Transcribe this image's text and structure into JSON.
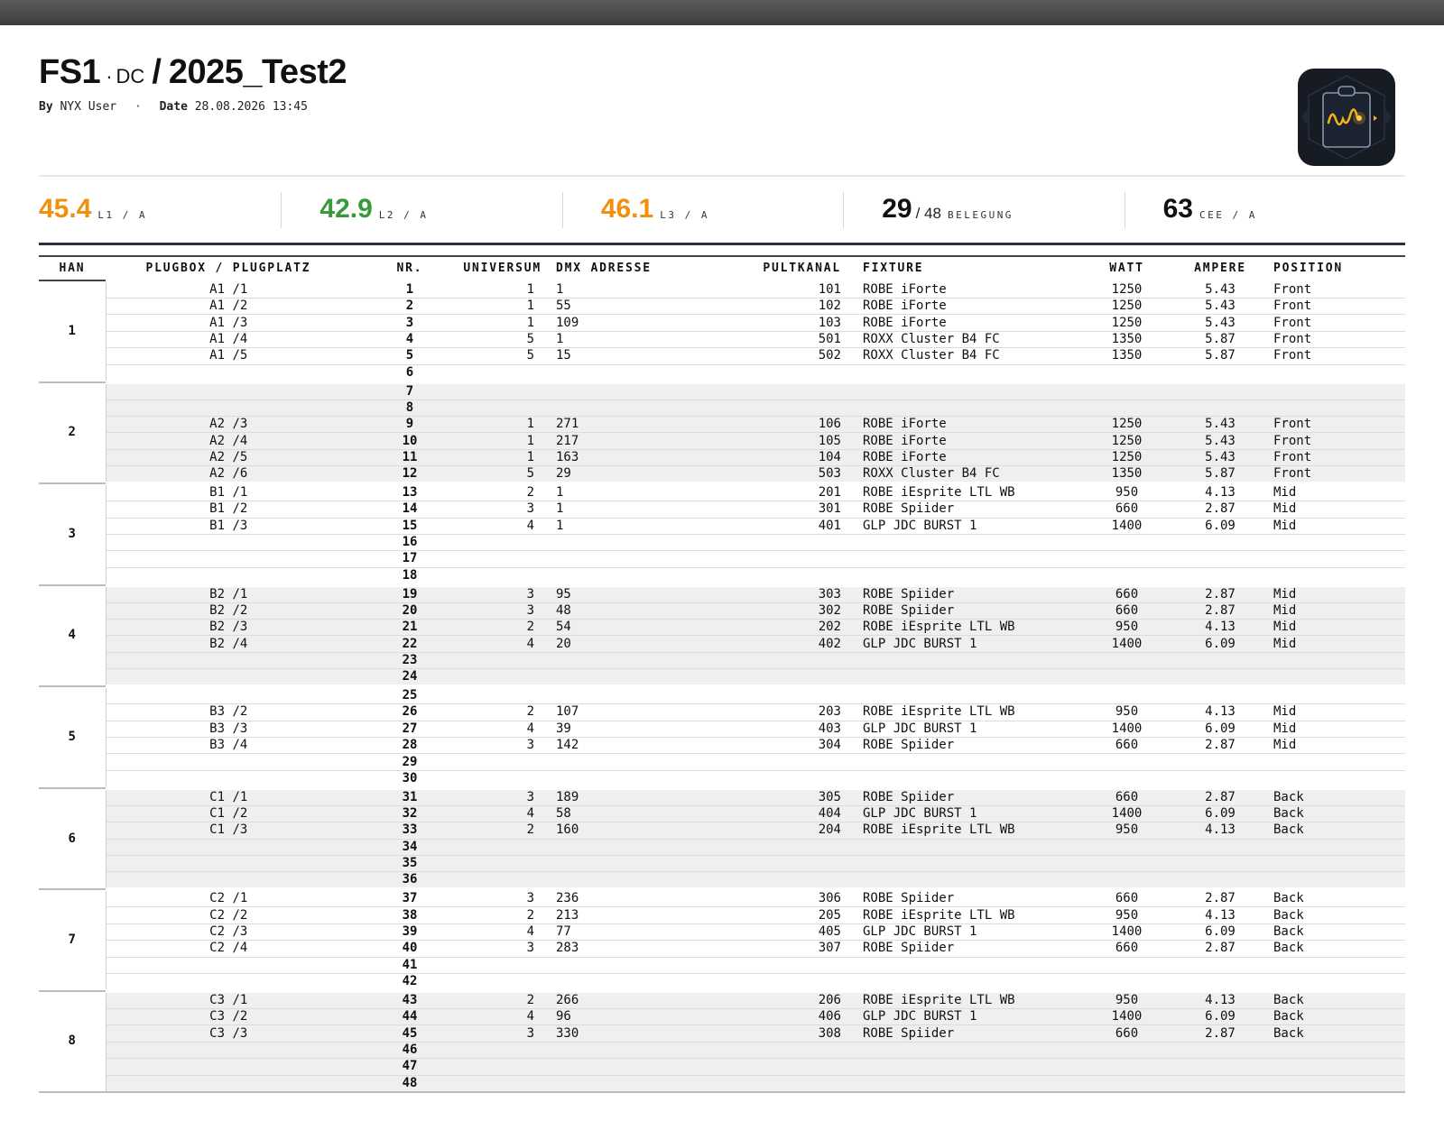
{
  "header": {
    "title_main": "FS1",
    "title_dot": "·",
    "title_sub": "DC",
    "title_slash": "/",
    "title_project": "2025_Test2",
    "by_label": "By",
    "by_value": "NYX User",
    "separator": "·",
    "date_label": "Date",
    "date_value": "28.08.2026 13:45",
    "logo_icon": "clipboard-waveform-icon"
  },
  "stats": [
    {
      "value": "45.4",
      "of": "",
      "unit": "L1 / A",
      "color": "#f0900f"
    },
    {
      "value": "42.9",
      "of": "",
      "unit": "L2 / A",
      "color": "#3a9a3a"
    },
    {
      "value": "46.1",
      "of": "",
      "unit": "L3 / A",
      "color": "#f0900f"
    },
    {
      "value": "29",
      "of": "/ 48",
      "unit": "BELEGUNG",
      "color": "#111111"
    },
    {
      "value": "63",
      "of": "",
      "unit": "CEE / A",
      "color": "#111111"
    }
  ],
  "columns": [
    "HAN",
    "PLUGBOX / PLUGPLATZ",
    "NR.",
    "UNIVERSUM",
    "DMX ADRESSE",
    "PULTKANAL",
    "FIXTURE",
    "WATT",
    "AMPERE",
    "POSITION"
  ],
  "groups": [
    {
      "han": "1",
      "rows": [
        {
          "pb": "A1 /1",
          "nr": "1",
          "uni": "1",
          "dmx": "1",
          "pult": "101",
          "fix": "ROBE iForte",
          "watt": "1250",
          "amp": "5.43",
          "pos": "Front"
        },
        {
          "pb": "A1 /2",
          "nr": "2",
          "uni": "1",
          "dmx": "55",
          "pult": "102",
          "fix": "ROBE iForte",
          "watt": "1250",
          "amp": "5.43",
          "pos": "Front"
        },
        {
          "pb": "A1 /3",
          "nr": "3",
          "uni": "1",
          "dmx": "109",
          "pult": "103",
          "fix": "ROBE iForte",
          "watt": "1250",
          "amp": "5.43",
          "pos": "Front"
        },
        {
          "pb": "A1 /4",
          "nr": "4",
          "uni": "5",
          "dmx": "1",
          "pult": "501",
          "fix": "ROXX Cluster B4 FC",
          "watt": "1350",
          "amp": "5.87",
          "pos": "Front"
        },
        {
          "pb": "A1 /5",
          "nr": "5",
          "uni": "5",
          "dmx": "15",
          "pult": "502",
          "fix": "ROXX Cluster B4 FC",
          "watt": "1350",
          "amp": "5.87",
          "pos": "Front"
        },
        {
          "pb": "",
          "nr": "6",
          "uni": "",
          "dmx": "",
          "pult": "",
          "fix": "",
          "watt": "",
          "amp": "",
          "pos": ""
        }
      ]
    },
    {
      "han": "2",
      "rows": [
        {
          "pb": "",
          "nr": "7",
          "uni": "",
          "dmx": "",
          "pult": "",
          "fix": "",
          "watt": "",
          "amp": "",
          "pos": ""
        },
        {
          "pb": "",
          "nr": "8",
          "uni": "",
          "dmx": "",
          "pult": "",
          "fix": "",
          "watt": "",
          "amp": "",
          "pos": ""
        },
        {
          "pb": "A2 /3",
          "nr": "9",
          "uni": "1",
          "dmx": "271",
          "pult": "106",
          "fix": "ROBE iForte",
          "watt": "1250",
          "amp": "5.43",
          "pos": "Front"
        },
        {
          "pb": "A2 /4",
          "nr": "10",
          "uni": "1",
          "dmx": "217",
          "pult": "105",
          "fix": "ROBE iForte",
          "watt": "1250",
          "amp": "5.43",
          "pos": "Front"
        },
        {
          "pb": "A2 /5",
          "nr": "11",
          "uni": "1",
          "dmx": "163",
          "pult": "104",
          "fix": "ROBE iForte",
          "watt": "1250",
          "amp": "5.43",
          "pos": "Front"
        },
        {
          "pb": "A2 /6",
          "nr": "12",
          "uni": "5",
          "dmx": "29",
          "pult": "503",
          "fix": "ROXX Cluster B4 FC",
          "watt": "1350",
          "amp": "5.87",
          "pos": "Front"
        }
      ]
    },
    {
      "han": "3",
      "rows": [
        {
          "pb": "B1 /1",
          "nr": "13",
          "uni": "2",
          "dmx": "1",
          "pult": "201",
          "fix": "ROBE iEsprite LTL WB",
          "watt": "950",
          "amp": "4.13",
          "pos": "Mid"
        },
        {
          "pb": "B1 /2",
          "nr": "14",
          "uni": "3",
          "dmx": "1",
          "pult": "301",
          "fix": "ROBE Spiider",
          "watt": "660",
          "amp": "2.87",
          "pos": "Mid"
        },
        {
          "pb": "B1 /3",
          "nr": "15",
          "uni": "4",
          "dmx": "1",
          "pult": "401",
          "fix": "GLP JDC BURST 1",
          "watt": "1400",
          "amp": "6.09",
          "pos": "Mid"
        },
        {
          "pb": "",
          "nr": "16",
          "uni": "",
          "dmx": "",
          "pult": "",
          "fix": "",
          "watt": "",
          "amp": "",
          "pos": ""
        },
        {
          "pb": "",
          "nr": "17",
          "uni": "",
          "dmx": "",
          "pult": "",
          "fix": "",
          "watt": "",
          "amp": "",
          "pos": ""
        },
        {
          "pb": "",
          "nr": "18",
          "uni": "",
          "dmx": "",
          "pult": "",
          "fix": "",
          "watt": "",
          "amp": "",
          "pos": ""
        }
      ]
    },
    {
      "han": "4",
      "rows": [
        {
          "pb": "B2 /1",
          "nr": "19",
          "uni": "3",
          "dmx": "95",
          "pult": "303",
          "fix": "ROBE Spiider",
          "watt": "660",
          "amp": "2.87",
          "pos": "Mid"
        },
        {
          "pb": "B2 /2",
          "nr": "20",
          "uni": "3",
          "dmx": "48",
          "pult": "302",
          "fix": "ROBE Spiider",
          "watt": "660",
          "amp": "2.87",
          "pos": "Mid"
        },
        {
          "pb": "B2 /3",
          "nr": "21",
          "uni": "2",
          "dmx": "54",
          "pult": "202",
          "fix": "ROBE iEsprite LTL WB",
          "watt": "950",
          "amp": "4.13",
          "pos": "Mid"
        },
        {
          "pb": "B2 /4",
          "nr": "22",
          "uni": "4",
          "dmx": "20",
          "pult": "402",
          "fix": "GLP JDC BURST 1",
          "watt": "1400",
          "amp": "6.09",
          "pos": "Mid"
        },
        {
          "pb": "",
          "nr": "23",
          "uni": "",
          "dmx": "",
          "pult": "",
          "fix": "",
          "watt": "",
          "amp": "",
          "pos": ""
        },
        {
          "pb": "",
          "nr": "24",
          "uni": "",
          "dmx": "",
          "pult": "",
          "fix": "",
          "watt": "",
          "amp": "",
          "pos": ""
        }
      ]
    },
    {
      "han": "5",
      "rows": [
        {
          "pb": "",
          "nr": "25",
          "uni": "",
          "dmx": "",
          "pult": "",
          "fix": "",
          "watt": "",
          "amp": "",
          "pos": ""
        },
        {
          "pb": "B3 /2",
          "nr": "26",
          "uni": "2",
          "dmx": "107",
          "pult": "203",
          "fix": "ROBE iEsprite LTL WB",
          "watt": "950",
          "amp": "4.13",
          "pos": "Mid"
        },
        {
          "pb": "B3 /3",
          "nr": "27",
          "uni": "4",
          "dmx": "39",
          "pult": "403",
          "fix": "GLP JDC BURST 1",
          "watt": "1400",
          "amp": "6.09",
          "pos": "Mid"
        },
        {
          "pb": "B3 /4",
          "nr": "28",
          "uni": "3",
          "dmx": "142",
          "pult": "304",
          "fix": "ROBE Spiider",
          "watt": "660",
          "amp": "2.87",
          "pos": "Mid"
        },
        {
          "pb": "",
          "nr": "29",
          "uni": "",
          "dmx": "",
          "pult": "",
          "fix": "",
          "watt": "",
          "amp": "",
          "pos": ""
        },
        {
          "pb": "",
          "nr": "30",
          "uni": "",
          "dmx": "",
          "pult": "",
          "fix": "",
          "watt": "",
          "amp": "",
          "pos": ""
        }
      ]
    },
    {
      "han": "6",
      "rows": [
        {
          "pb": "C1 /1",
          "nr": "31",
          "uni": "3",
          "dmx": "189",
          "pult": "305",
          "fix": "ROBE Spiider",
          "watt": "660",
          "amp": "2.87",
          "pos": "Back"
        },
        {
          "pb": "C1 /2",
          "nr": "32",
          "uni": "4",
          "dmx": "58",
          "pult": "404",
          "fix": "GLP JDC BURST 1",
          "watt": "1400",
          "amp": "6.09",
          "pos": "Back"
        },
        {
          "pb": "C1 /3",
          "nr": "33",
          "uni": "2",
          "dmx": "160",
          "pult": "204",
          "fix": "ROBE iEsprite LTL WB",
          "watt": "950",
          "amp": "4.13",
          "pos": "Back"
        },
        {
          "pb": "",
          "nr": "34",
          "uni": "",
          "dmx": "",
          "pult": "",
          "fix": "",
          "watt": "",
          "amp": "",
          "pos": ""
        },
        {
          "pb": "",
          "nr": "35",
          "uni": "",
          "dmx": "",
          "pult": "",
          "fix": "",
          "watt": "",
          "amp": "",
          "pos": ""
        },
        {
          "pb": "",
          "nr": "36",
          "uni": "",
          "dmx": "",
          "pult": "",
          "fix": "",
          "watt": "",
          "amp": "",
          "pos": ""
        }
      ]
    },
    {
      "han": "7",
      "rows": [
        {
          "pb": "C2 /1",
          "nr": "37",
          "uni": "3",
          "dmx": "236",
          "pult": "306",
          "fix": "ROBE Spiider",
          "watt": "660",
          "amp": "2.87",
          "pos": "Back"
        },
        {
          "pb": "C2 /2",
          "nr": "38",
          "uni": "2",
          "dmx": "213",
          "pult": "205",
          "fix": "ROBE iEsprite LTL WB",
          "watt": "950",
          "amp": "4.13",
          "pos": "Back"
        },
        {
          "pb": "C2 /3",
          "nr": "39",
          "uni": "4",
          "dmx": "77",
          "pult": "405",
          "fix": "GLP JDC BURST 1",
          "watt": "1400",
          "amp": "6.09",
          "pos": "Back"
        },
        {
          "pb": "C2 /4",
          "nr": "40",
          "uni": "3",
          "dmx": "283",
          "pult": "307",
          "fix": "ROBE Spiider",
          "watt": "660",
          "amp": "2.87",
          "pos": "Back"
        },
        {
          "pb": "",
          "nr": "41",
          "uni": "",
          "dmx": "",
          "pult": "",
          "fix": "",
          "watt": "",
          "amp": "",
          "pos": ""
        },
        {
          "pb": "",
          "nr": "42",
          "uni": "",
          "dmx": "",
          "pult": "",
          "fix": "",
          "watt": "",
          "amp": "",
          "pos": ""
        }
      ]
    },
    {
      "han": "8",
      "rows": [
        {
          "pb": "C3 /1",
          "nr": "43",
          "uni": "2",
          "dmx": "266",
          "pult": "206",
          "fix": "ROBE iEsprite LTL WB",
          "watt": "950",
          "amp": "4.13",
          "pos": "Back"
        },
        {
          "pb": "C3 /2",
          "nr": "44",
          "uni": "4",
          "dmx": "96",
          "pult": "406",
          "fix": "GLP JDC BURST 1",
          "watt": "1400",
          "amp": "6.09",
          "pos": "Back"
        },
        {
          "pb": "C3 /3",
          "nr": "45",
          "uni": "3",
          "dmx": "330",
          "pult": "308",
          "fix": "ROBE Spiider",
          "watt": "660",
          "amp": "2.87",
          "pos": "Back"
        },
        {
          "pb": "",
          "nr": "46",
          "uni": "",
          "dmx": "",
          "pult": "",
          "fix": "",
          "watt": "",
          "amp": "",
          "pos": ""
        },
        {
          "pb": "",
          "nr": "47",
          "uni": "",
          "dmx": "",
          "pult": "",
          "fix": "",
          "watt": "",
          "amp": "",
          "pos": ""
        },
        {
          "pb": "",
          "nr": "48",
          "uni": "",
          "dmx": "",
          "pult": "",
          "fix": "",
          "watt": "",
          "amp": "",
          "pos": ""
        }
      ]
    }
  ]
}
